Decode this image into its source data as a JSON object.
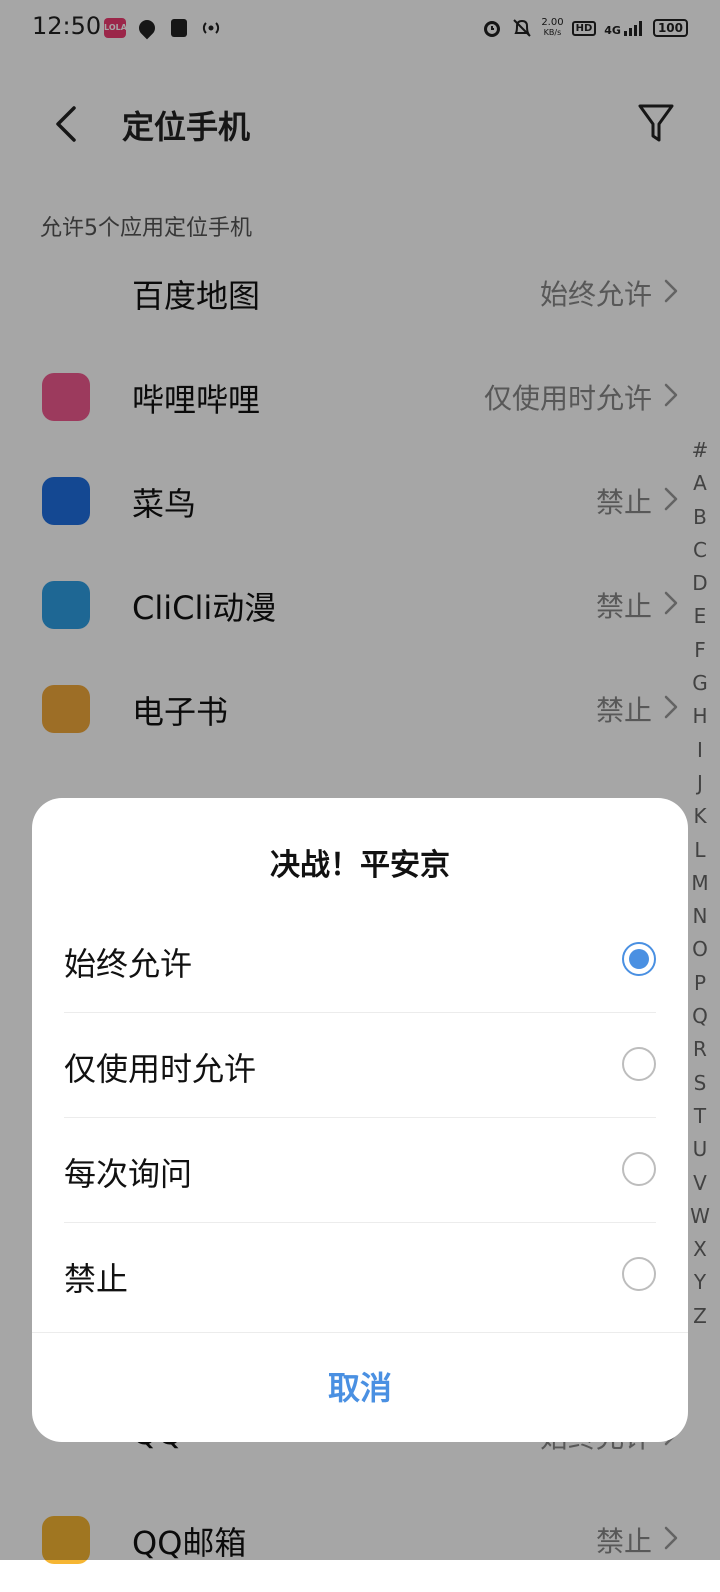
{
  "status_bar": {
    "time": "12:50",
    "lola_text": "LOLA",
    "speed_value": "2.00",
    "speed_unit": "KB/s",
    "hd": "HD",
    "network": "4G",
    "battery": "100"
  },
  "header": {
    "title": "定位手机"
  },
  "subtitle": "允许5个应用定位手机",
  "apps": [
    {
      "name": "百度地图",
      "status": "始终允许",
      "icon": "baidu-maps-icon",
      "color": "#ffffff"
    },
    {
      "name": "哔哩哔哩",
      "status": "仅使用时允许",
      "icon": "bilibili-icon",
      "color": "#f05a8f"
    },
    {
      "name": "菜鸟",
      "status": "禁止",
      "icon": "cainiao-icon",
      "color": "#1f6fe0"
    },
    {
      "name": "CliCli动漫",
      "status": "禁止",
      "icon": "clicli-icon",
      "color": "#2f9ee3"
    },
    {
      "name": "电子书",
      "status": "禁止",
      "icon": "ebook-icon",
      "color": "#f2a93b"
    },
    {
      "name": "QQ",
      "status": "始终允许",
      "icon": "qq-icon",
      "color": "#ffffff"
    },
    {
      "name": "QQ邮箱",
      "status": "禁止",
      "icon": "qq-mail-icon",
      "color": "#f6b633"
    }
  ],
  "alphabet": [
    "#",
    "A",
    "B",
    "C",
    "D",
    "E",
    "F",
    "G",
    "H",
    "I",
    "J",
    "K",
    "L",
    "M",
    "N",
    "O",
    "P",
    "Q",
    "R",
    "S",
    "T",
    "U",
    "V",
    "W",
    "X",
    "Y",
    "Z"
  ],
  "dialog": {
    "title": "决战！平安京",
    "options": [
      {
        "label": "始终允许",
        "selected": true
      },
      {
        "label": "仅使用时允许",
        "selected": false
      },
      {
        "label": "每次询问",
        "selected": false
      },
      {
        "label": "禁止",
        "selected": false
      }
    ],
    "cancel": "取消"
  },
  "colors": {
    "accent": "#4a90e2"
  }
}
